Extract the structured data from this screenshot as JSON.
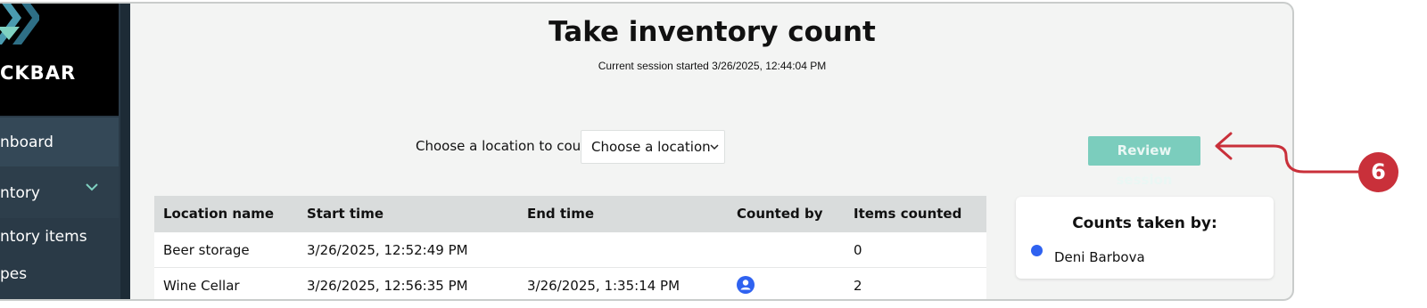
{
  "sidebar": {
    "logo_text": "CKBAR",
    "items": [
      {
        "label": "nboard"
      },
      {
        "label": "ntory"
      },
      {
        "label": "ntory items"
      },
      {
        "label": "pes"
      }
    ]
  },
  "header": {
    "title": "Take inventory count",
    "session_info": "Current session started 3/26/2025, 12:44:04 PM"
  },
  "location": {
    "label": "Choose a location to count",
    "selected": "Choose a location"
  },
  "review_button": {
    "label": "Review session"
  },
  "table": {
    "columns": [
      "Location name",
      "Start time",
      "End time",
      "Counted by",
      "Items counted"
    ],
    "rows": [
      {
        "location": "Beer storage",
        "start": "3/26/2025, 12:52:49 PM",
        "end": "",
        "counted": "0"
      },
      {
        "location": "Wine Cellar",
        "start": "3/26/2025, 12:56:35 PM",
        "end": "3/26/2025, 1:35:14 PM",
        "counted": "2"
      }
    ]
  },
  "counts_panel": {
    "title": "Counts taken by:",
    "users": [
      {
        "name": "Deni Barbova",
        "color": "#2f62f0"
      }
    ]
  },
  "callout": {
    "number": "6",
    "color": "#c9303a"
  },
  "colors": {
    "accent": "#7bcdbd",
    "sidebar": "#2a3a47"
  }
}
